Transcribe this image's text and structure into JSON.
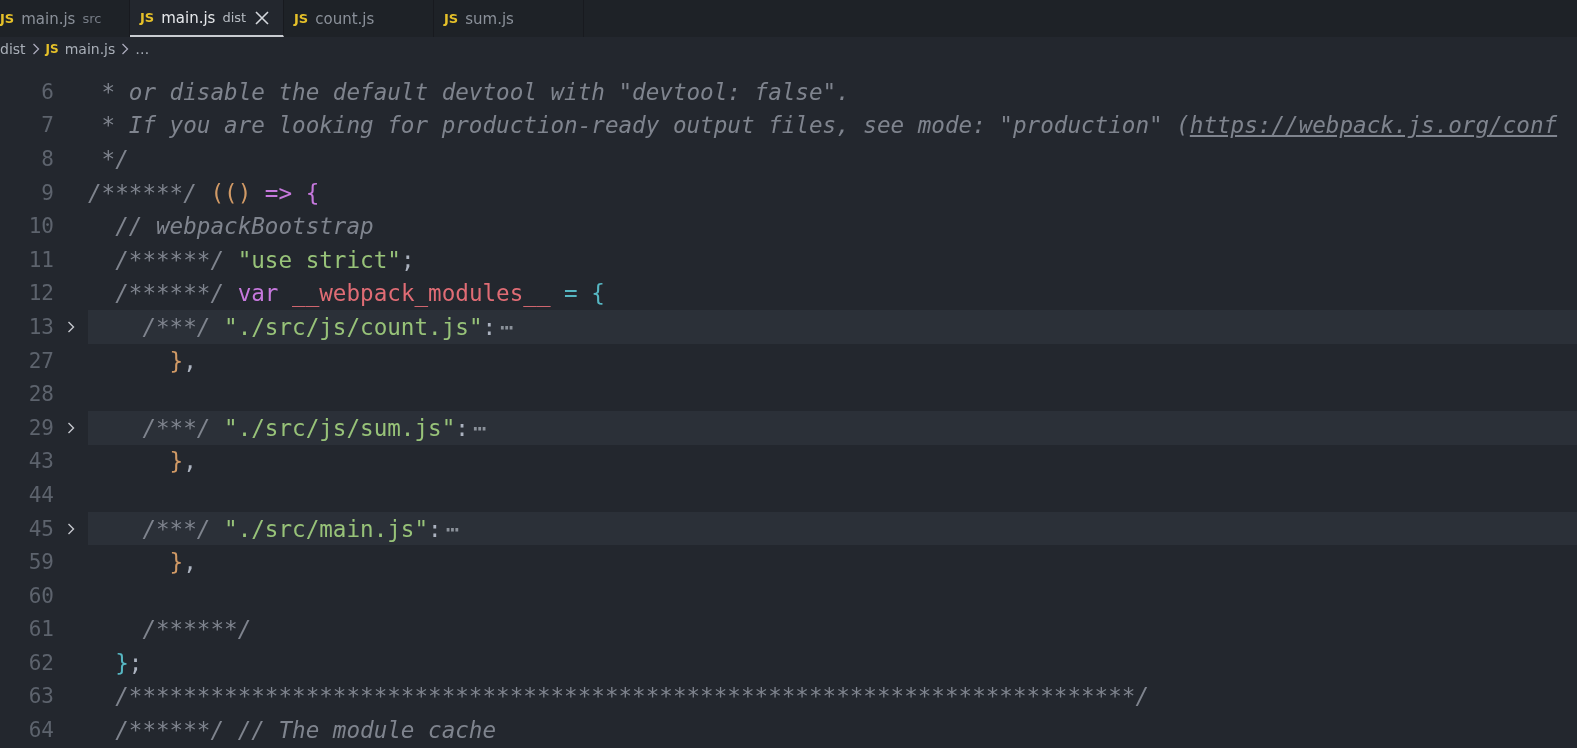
{
  "tabs": [
    {
      "icon": "JS",
      "label": "main.js",
      "description": "src",
      "selected": false
    },
    {
      "icon": "JS",
      "label": "main.js",
      "description": "dist",
      "selected": true
    },
    {
      "icon": "JS",
      "label": "count.js",
      "selected": false
    },
    {
      "icon": "JS",
      "label": "sum.js",
      "selected": false
    }
  ],
  "breadcrumb": [
    {
      "label": "dist"
    },
    {
      "icon": "JS",
      "label": "main.js"
    },
    {
      "label": "…"
    }
  ],
  "lines": [
    {
      "number": "6",
      "folded": false,
      "tokens": [
        {
          "kind": "comment",
          "text": " * or disable the default devtool with \"devtool: false\"."
        }
      ]
    },
    {
      "number": "7",
      "folded": false,
      "tokens": [
        {
          "kind": "comment",
          "text": " * If you are looking for production-ready output files, see mode: \"production\" ("
        },
        {
          "kind": "link",
          "text": "https://webpack.js.org/conf"
        }
      ]
    },
    {
      "number": "8",
      "folded": false,
      "tokens": [
        {
          "kind": "comment",
          "text": " */"
        }
      ]
    },
    {
      "number": "9",
      "folded": false,
      "tokens": [
        {
          "kind": "comment",
          "text": "/******/ "
        },
        {
          "kind": "bracket-orange",
          "text": "(()"
        },
        {
          "kind": "keyword",
          "text": " => "
        },
        {
          "kind": "bracket-purple",
          "text": "{"
        }
      ]
    },
    {
      "number": "10",
      "folded": false,
      "tokens": [
        {
          "kind": "comment",
          "text": "  // webpackBootstrap"
        }
      ]
    },
    {
      "number": "11",
      "folded": false,
      "tokens": [
        {
          "kind": "comment",
          "text": "  /******/ "
        },
        {
          "kind": "string",
          "text": "\"use strict\""
        },
        {
          "kind": "punct",
          "text": ";"
        }
      ]
    },
    {
      "number": "12",
      "folded": false,
      "tokens": [
        {
          "kind": "comment",
          "text": "  /******/ "
        },
        {
          "kind": "keyword",
          "text": "var "
        },
        {
          "kind": "variable",
          "text": "__webpack_modules__"
        },
        {
          "kind": "operator",
          "text": " = "
        },
        {
          "kind": "bracket-cyan",
          "text": "{"
        }
      ]
    },
    {
      "number": "13",
      "folded": true,
      "tokens": [
        {
          "kind": "comment",
          "text": "    /***/ "
        },
        {
          "kind": "string",
          "text": "\"./src/js/count.js\""
        },
        {
          "kind": "punct",
          "text": ":"
        },
        {
          "kind": "ellipsis",
          "text": "⋯"
        }
      ]
    },
    {
      "number": "27",
      "folded": false,
      "tokens": [
        {
          "kind": "bracket-orange",
          "text": "      }"
        },
        {
          "kind": "punct",
          "text": ","
        }
      ]
    },
    {
      "number": "28",
      "folded": false
    },
    {
      "number": "29",
      "folded": true,
      "tokens": [
        {
          "kind": "comment",
          "text": "    /***/ "
        },
        {
          "kind": "string",
          "text": "\"./src/js/sum.js\""
        },
        {
          "kind": "punct",
          "text": ":"
        },
        {
          "kind": "ellipsis",
          "text": "⋯"
        }
      ]
    },
    {
      "number": "43",
      "folded": false,
      "tokens": [
        {
          "kind": "bracket-orange",
          "text": "      }"
        },
        {
          "kind": "punct",
          "text": ","
        }
      ]
    },
    {
      "number": "44",
      "folded": false
    },
    {
      "number": "45",
      "folded": true,
      "tokens": [
        {
          "kind": "comment",
          "text": "    /***/ "
        },
        {
          "kind": "string",
          "text": "\"./src/main.js\""
        },
        {
          "kind": "punct",
          "text": ":"
        },
        {
          "kind": "ellipsis",
          "text": "⋯"
        }
      ]
    },
    {
      "number": "59",
      "folded": false,
      "tokens": [
        {
          "kind": "bracket-orange",
          "text": "      }"
        },
        {
          "kind": "punct",
          "text": ","
        }
      ]
    },
    {
      "number": "60",
      "folded": false
    },
    {
      "number": "61",
      "folded": false,
      "tokens": [
        {
          "kind": "comment",
          "text": "    /******/"
        }
      ]
    },
    {
      "number": "62",
      "folded": false,
      "tokens": [
        {
          "kind": "bracket-cyan",
          "text": "  }"
        },
        {
          "kind": "punct",
          "text": ";"
        }
      ]
    },
    {
      "number": "63",
      "folded": false,
      "tokens": [
        {
          "kind": "comment",
          "text": "  /**************************************************************************/"
        }
      ]
    },
    {
      "number": "64",
      "folded": false,
      "tokens": [
        {
          "kind": "comment",
          "text": "  /******/ // The module cache"
        }
      ]
    }
  ]
}
